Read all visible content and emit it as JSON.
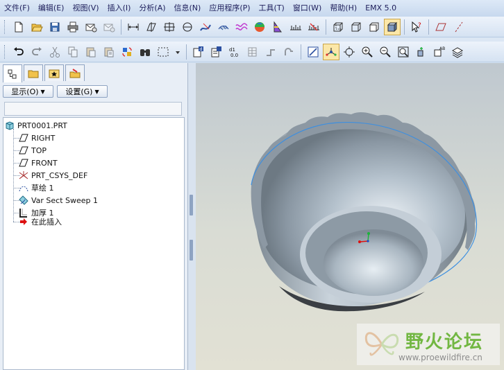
{
  "menu": [
    "文件(F)",
    "编辑(E)",
    "视图(V)",
    "插入(I)",
    "分析(A)",
    "信息(N)",
    "应用程序(P)",
    "工具(T)",
    "窗口(W)",
    "帮助(H)",
    "EMX 5.0"
  ],
  "panel": {
    "show_button": "显示(O)",
    "settings_button": "设置(G)"
  },
  "tree": {
    "root": "PRT0001.PRT",
    "items": [
      "RIGHT",
      "TOP",
      "FRONT",
      "PRT_CSYS_DEF",
      "草绘 1",
      "Var Sect Sweep 1",
      "加厚 1",
      "在此插入"
    ]
  },
  "watermark": {
    "title": "野火论坛",
    "url": "www.proewildfire.cn"
  }
}
